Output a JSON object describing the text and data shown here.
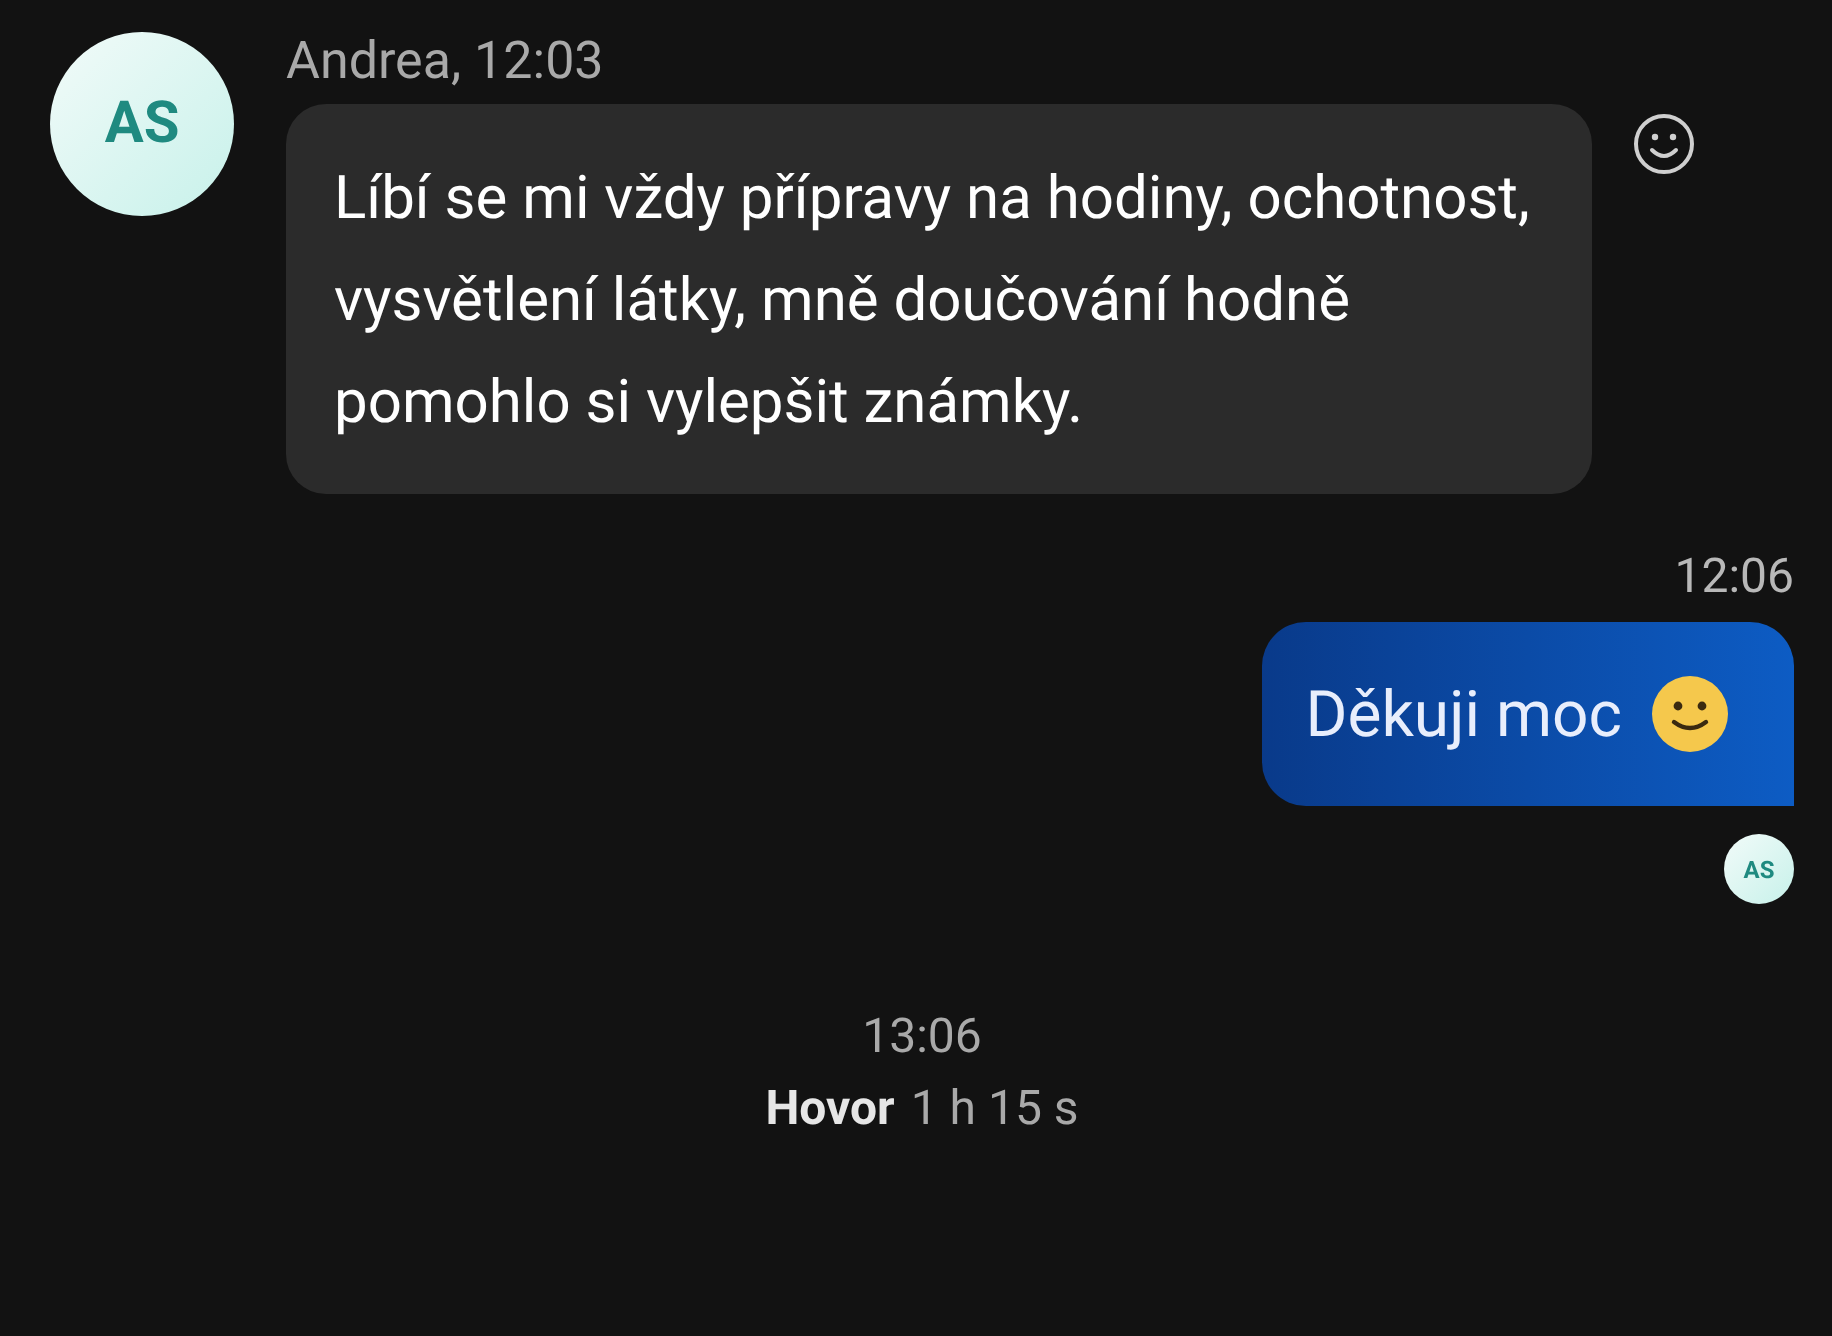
{
  "messages": [
    {
      "kind": "incoming",
      "avatar": "AS",
      "sender": "Andrea, 12:03",
      "text": "Líbí se mi vždy přípravy na hodiny, ochotnost, vysvětlení látky, mně doučování hodně pomohlo si vylepšit známky."
    },
    {
      "kind": "outgoing",
      "time": "12:06",
      "text": "Děkuji moc",
      "read_avatar": "AS"
    }
  ],
  "call": {
    "time": "13:06",
    "label": "Hovor",
    "duration": "1 h 15 s"
  }
}
